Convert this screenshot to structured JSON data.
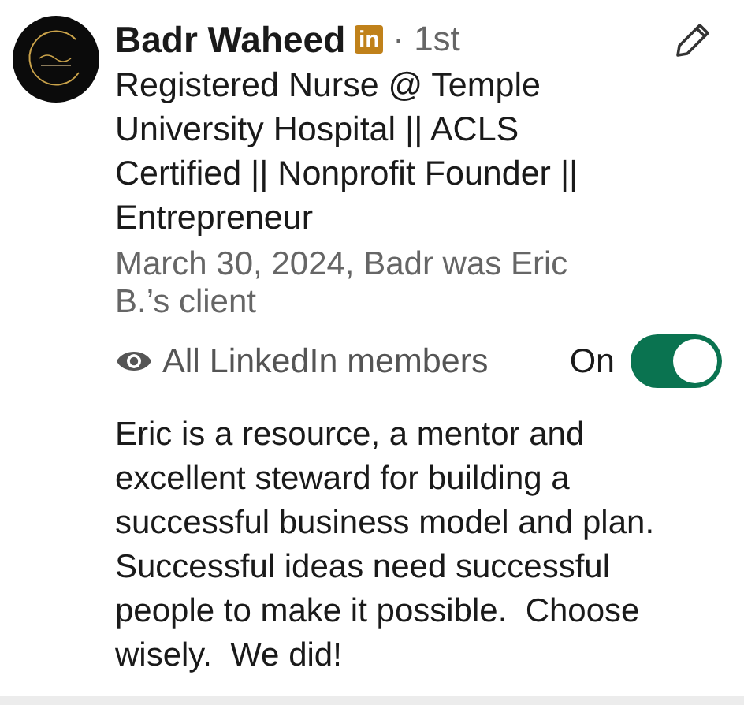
{
  "recommendation": {
    "name": "Badr Waheed",
    "badge": "in",
    "degree": "· 1st",
    "headline_lines": [
      "Registered Nurse @ Temple",
      "University Hospital || ACLS",
      "Certified || Nonprofit Founder ||",
      "Entrepreneur"
    ],
    "relationship_lines": [
      "March 30, 2024, Badr was Eric",
      "B.’s client"
    ],
    "visibility": "All LinkedIn members",
    "toggle": {
      "label": "On",
      "on": true
    },
    "text_lines": [
      "Eric is a resource, a mentor and",
      "excellent steward for building a",
      "successful business model and plan.",
      "Successful ideas need successful",
      "people to make it possible.  Choose",
      "wisely.  We did!"
    ]
  }
}
